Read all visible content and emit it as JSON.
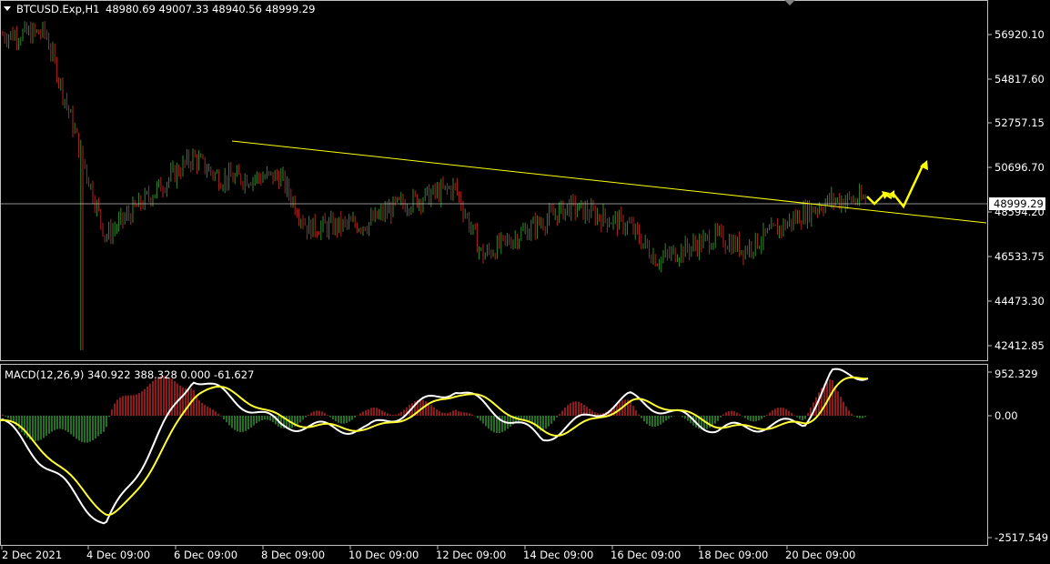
{
  "header": {
    "symbol": "BTCUSD.Exp,H1",
    "ohlc": "48980.69 49007.33 48940.56 48999.29"
  },
  "price_axis": {
    "ticks": [
      "56920.10",
      "54817.60",
      "52757.15",
      "50696.70",
      "48594.20",
      "46533.75",
      "44473.30",
      "42412.85"
    ],
    "current_price": "48999.29"
  },
  "macd": {
    "label": "MACD(12,26,9) 340.922 388.328 0.000 -61.627",
    "ticks": [
      "952.329",
      "0.00",
      "-2517.549"
    ]
  },
  "time_axis": {
    "ticks": [
      "2 Dec 2021",
      "4 Dec 09:00",
      "6 Dec 09:00",
      "8 Dec 09:00",
      "10 Dec 09:00",
      "12 Dec 09:00",
      "14 Dec 09:00",
      "16 Dec 09:00",
      "18 Dec 09:00",
      "20 Dec 09:00"
    ]
  },
  "colors": {
    "background": "#000000",
    "bull_candle": "#2e8b2e",
    "bear_candle": "#b22222",
    "trendline": "#ffff00",
    "macd_main": "#ffffff",
    "macd_signal": "#ffff33",
    "grid_line": "#c0c0c0"
  },
  "chart_data": {
    "type": "candlestick",
    "symbol": "BTCUSD.Exp",
    "timeframe": "H1",
    "x_range": [
      "2 Dec 2021",
      "20 Dec 09:00"
    ],
    "price_close_path": [
      [
        "2 Dec 2021",
        56900
      ],
      [
        "3 Dec 2021",
        57000
      ],
      [
        "4 Dec 09:00",
        47500
      ],
      [
        "5 Dec 2021",
        48700
      ],
      [
        "6 Dec 09:00",
        51200
      ],
      [
        "7 Dec 2021",
        50200
      ],
      [
        "8 Dec 09:00",
        50300
      ],
      [
        "9 Dec 2021",
        47900
      ],
      [
        "10 Dec 09:00",
        48100
      ],
      [
        "11 Dec 2021",
        48900
      ],
      [
        "12 Dec 09:00",
        49800
      ],
      [
        "13 Dec 2021",
        46600
      ],
      [
        "14 Dec 09:00",
        48200
      ],
      [
        "15 Dec 2021",
        48900
      ],
      [
        "16 Dec 09:00",
        48000
      ],
      [
        "17 Dec 2021",
        46400
      ],
      [
        "18 Dec 09:00",
        47500
      ],
      [
        "19 Dec 2021",
        46900
      ],
      [
        "20 Dec 09:00",
        48600
      ],
      [
        "21 Dec 2021",
        49200
      ]
    ],
    "price_low": 42200,
    "trendline": {
      "from": [
        "6 Dec 09:00",
        51300
      ],
      "to": [
        "21 Dec 2021",
        48300
      ]
    },
    "macd_path": [
      [
        "2 Dec 2021",
        -100
      ],
      [
        "4 Dec 09:00",
        -2400
      ],
      [
        "6 Dec 09:00",
        850
      ],
      [
        "8 Dec 09:00",
        -200
      ],
      [
        "10 Dec 09:00",
        -300
      ],
      [
        "12 Dec 09:00",
        600
      ],
      [
        "14 Dec 09:00",
        -500
      ],
      [
        "16 Dec 09:00",
        400
      ],
      [
        "18 Dec 09:00",
        -300
      ],
      [
        "20 Dec 09:00",
        -150
      ],
      [
        "21 Dec 2021",
        900
      ]
    ],
    "macd_ylim": [
      -2517.549,
      952.329
    ],
    "price_ylim": [
      42412.85,
      56920.1
    ]
  }
}
